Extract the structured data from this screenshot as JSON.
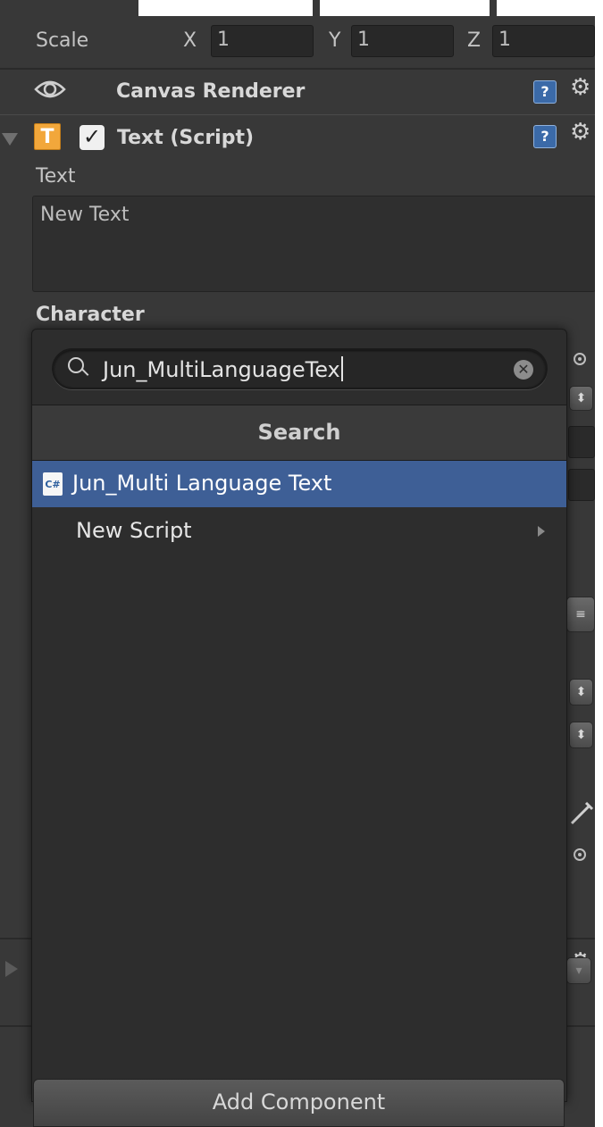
{
  "transform": {
    "scale_label": "Scale",
    "x_label": "X",
    "x_value": "1",
    "y_label": "Y",
    "y_value": "1",
    "z_label": "Z",
    "z_value": "1"
  },
  "canvas_renderer": {
    "title": "Canvas Renderer",
    "icons": {
      "visibility": "eye-icon",
      "help": "help-icon",
      "settings": "gear-icon"
    }
  },
  "text_script": {
    "title": "Text (Script)",
    "icon": "T",
    "enabled": true,
    "text_label": "Text",
    "text_value": "New Text",
    "character_label": "Character"
  },
  "add_component_popup": {
    "search_query": "Jun_MultiLanguageTex",
    "section_title": "Search",
    "results": [
      {
        "label": "Jun_Multi Language Text",
        "icon": "C#",
        "selected": true
      },
      {
        "label": "New Script",
        "has_submenu": true,
        "selected": false
      }
    ]
  },
  "footer": {
    "add_component_label": "Add Component"
  },
  "colors": {
    "panel_bg": "#383838",
    "popup_bg": "#2d2d2d",
    "selection": "#3e5f96",
    "script_icon": "#f2a73b"
  }
}
